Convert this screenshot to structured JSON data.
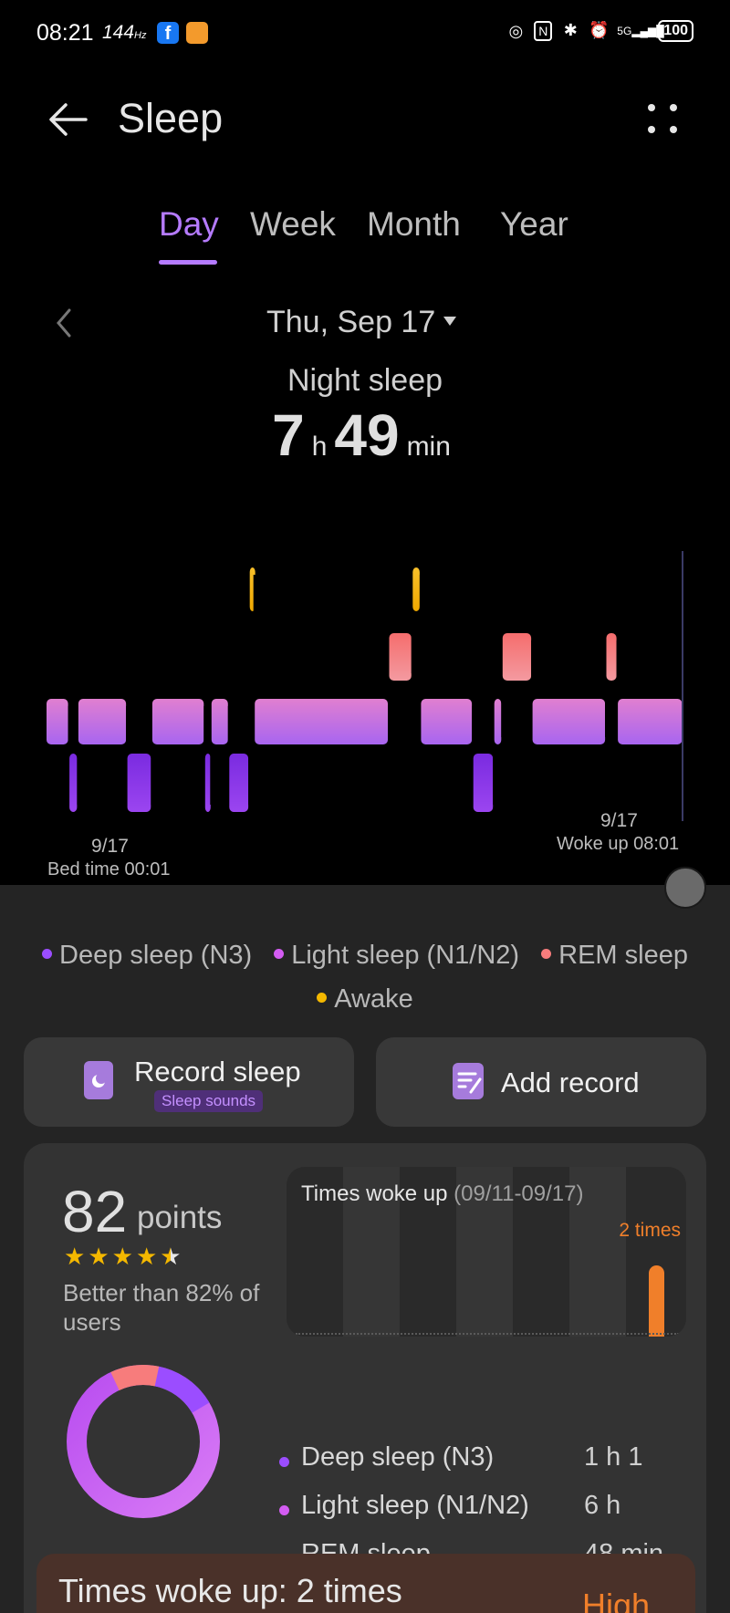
{
  "status_bar": {
    "time": "08:21",
    "refresh_rate": "144",
    "battery": "100",
    "network": "5G"
  },
  "header": {
    "title": "Sleep"
  },
  "tabs": [
    {
      "label": "Day",
      "active": true
    },
    {
      "label": "Week",
      "active": false
    },
    {
      "label": "Month",
      "active": false
    },
    {
      "label": "Year",
      "active": false
    }
  ],
  "date": {
    "label": "Thu, Sep 17"
  },
  "summary": {
    "label": "Night sleep",
    "hours": "7",
    "hours_unit": "h",
    "minutes": "49",
    "minutes_unit": "min"
  },
  "hypnogram": {
    "start_date": "9/17",
    "start_label": "Bed time 00:01",
    "end_date": "9/17",
    "end_label": "Woke up 08:01",
    "stage_colors": {
      "deep": "#8a35e6",
      "light": "#c46ae8",
      "rem": "#f08080",
      "awake": "#f4b800"
    },
    "segments": [
      {
        "stage": "light",
        "start": 0.0,
        "end": 0.036
      },
      {
        "stage": "deep",
        "start": 0.036,
        "end": 0.05
      },
      {
        "stage": "light",
        "start": 0.05,
        "end": 0.127
      },
      {
        "stage": "deep",
        "start": 0.127,
        "end": 0.166
      },
      {
        "stage": "light",
        "start": 0.166,
        "end": 0.249
      },
      {
        "stage": "deep",
        "start": 0.249,
        "end": 0.259
      },
      {
        "stage": "light",
        "start": 0.259,
        "end": 0.287
      },
      {
        "stage": "deep",
        "start": 0.287,
        "end": 0.319
      },
      {
        "stage": "awake",
        "start": 0.319,
        "end": 0.327
      },
      {
        "stage": "light",
        "start": 0.327,
        "end": 0.538
      },
      {
        "stage": "rem",
        "start": 0.538,
        "end": 0.575
      },
      {
        "stage": "awake",
        "start": 0.575,
        "end": 0.588
      },
      {
        "stage": "light",
        "start": 0.588,
        "end": 0.67
      },
      {
        "stage": "deep",
        "start": 0.67,
        "end": 0.703
      },
      {
        "stage": "light",
        "start": 0.703,
        "end": 0.716
      },
      {
        "stage": "rem",
        "start": 0.716,
        "end": 0.763
      },
      {
        "stage": "light",
        "start": 0.763,
        "end": 0.879
      },
      {
        "stage": "rem",
        "start": 0.879,
        "end": 0.897
      },
      {
        "stage": "light",
        "start": 0.897,
        "end": 1.0
      }
    ]
  },
  "legend": [
    {
      "label": "Deep sleep (N3)",
      "color": "#9b4dff"
    },
    {
      "label": "Light sleep (N1/N2)",
      "color": "#d35cf2"
    },
    {
      "label": "REM sleep",
      "color": "#f77c7c"
    },
    {
      "label": "Awake",
      "color": "#f4b800"
    }
  ],
  "actions": {
    "record_label": "Record sleep",
    "record_badge": "Sleep sounds",
    "add_label": "Add record"
  },
  "score": {
    "value": "82",
    "unit": "points",
    "stars": 4.5,
    "comparison": "Better than 82% of users"
  },
  "woke_chart": {
    "title": "Times woke up",
    "range": "(09/11-09/17)",
    "value_label": "2 times"
  },
  "breakdown": {
    "stages": [
      {
        "label": "Deep sleep (N3)",
        "value": "1 h 1",
        "color": "#9b4dff"
      },
      {
        "label": "Light sleep (N1/N2)",
        "value": "6 h",
        "color": "#d35cf2"
      },
      {
        "label": "REM sleep",
        "value": "48 min",
        "color": "#f77c7c"
      }
    ],
    "donut_fractions": {
      "deep": 0.13,
      "light": 0.77,
      "rem": 0.1
    }
  },
  "woke_summary": {
    "text": "Times woke up: 2 times",
    "level": "High"
  }
}
